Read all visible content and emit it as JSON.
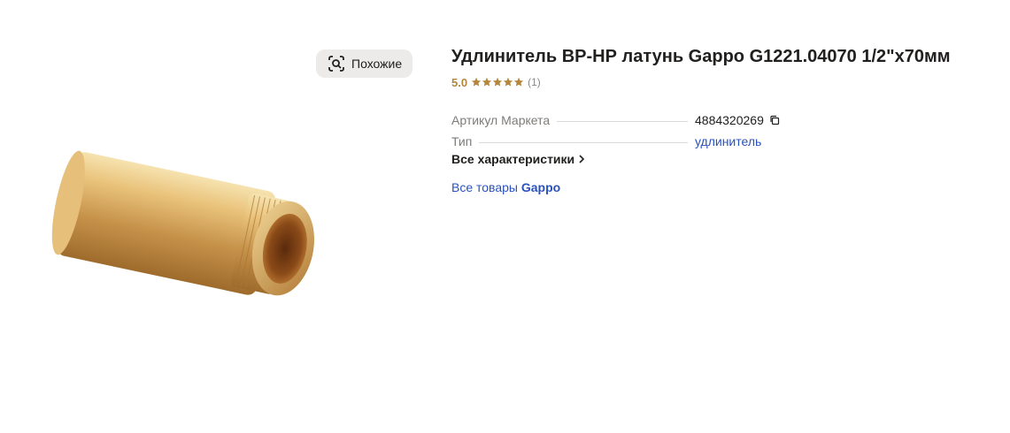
{
  "gallery": {
    "similar_button_label": "Похожие",
    "similar_icon": "scan-similar-icon"
  },
  "product": {
    "title": "Удлинитель ВР-НР латунь Gappo G1221.04070 1/2\"x70мм",
    "rating_value": "5.0",
    "rating_stars": 5,
    "reviews_count": "(1)",
    "specs": [
      {
        "label": "Артикул Маркета",
        "value": "4884320269"
      },
      {
        "label": "Тип",
        "value": "удлинитель"
      }
    ],
    "all_characteristics_label": "Все характеристики",
    "all_goods_prefix": "Все товары",
    "all_goods_brand": "Gappo"
  },
  "colors": {
    "rating": "#b4863c",
    "link": "#2a52be",
    "button_bg": "#ecebea"
  }
}
